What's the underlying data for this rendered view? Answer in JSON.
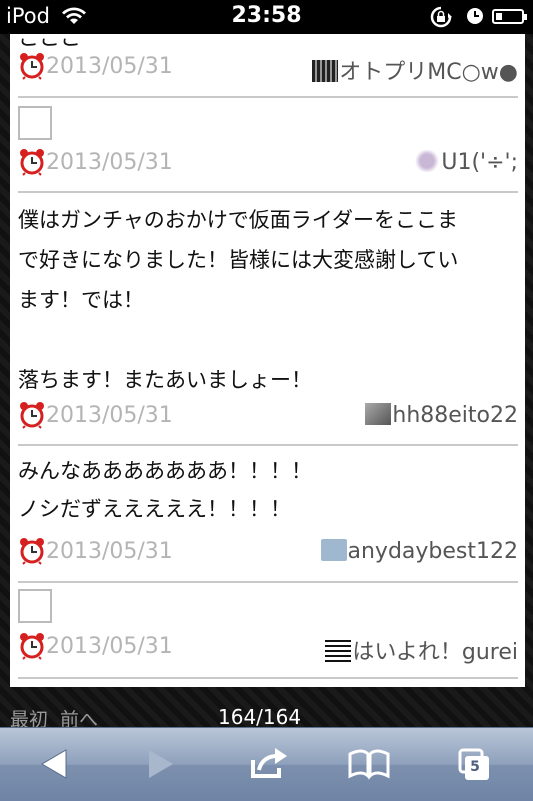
{
  "status_bar": {
    "carrier": "iPod",
    "time": "23:58"
  },
  "page": {
    "posts": [
      {
        "date": "2013/05/31",
        "user": "オトプリMC○w●"
      },
      {
        "date": "2013/05/31",
        "user": "U1('÷';"
      },
      {
        "message": [
          "僕はガンチャのおかけで仮面ライダーをここま",
          "で好きになりました！皆様には大変感謝してい",
          "ます！では！",
          "",
          "落ちます！またあいましょー！"
        ],
        "date": "2013/05/31",
        "user": "hh88eito22"
      },
      {
        "message": [
          "みんなあああああああ！！！！",
          "ノシだずえええええ！！！！"
        ],
        "date": "2013/05/31",
        "user": "anydaybest122"
      },
      {
        "date": "2013/05/31",
        "user": "はいよれ！gurei"
      }
    ]
  },
  "pager": {
    "first": "最初",
    "prev": "前へ",
    "count": "164/164"
  },
  "toolbar": {
    "tabs_count": "5"
  },
  "colors": {
    "toolbar": "#8ea0bb",
    "date": "#b4b4b4",
    "alarm": "#d62020"
  }
}
